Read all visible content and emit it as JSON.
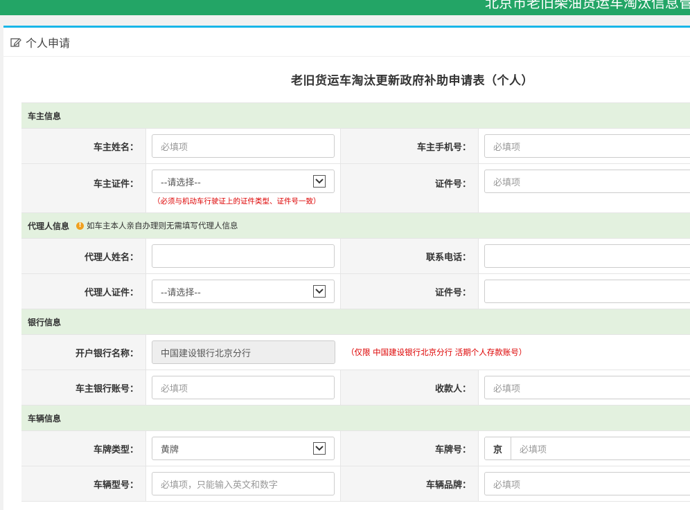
{
  "header": {
    "title": "北京市老旧柴油货运车淘汰信息管理"
  },
  "panel": {
    "title": "个人申请"
  },
  "form": {
    "title": "老旧货运车淘汰更新政府补助申请表（个人）",
    "owner_section": "车主信息",
    "owner_name_label": "车主姓名：",
    "owner_name_placeholder": "必填项",
    "owner_phone_label": "车主手机号：",
    "owner_phone_placeholder": "必填项",
    "owner_id_type_label": "车主证件：",
    "owner_id_type_value": "--请选择--",
    "owner_id_hint": "（必须与机动车行驶证上的证件类型、证件号一致）",
    "owner_id_no_label": "证件号：",
    "owner_id_no_placeholder": "必填项",
    "agent_section": "代理人信息",
    "agent_note": "如车主本人亲自办理则无需填写代理人信息",
    "agent_name_label": "代理人姓名：",
    "agent_phone_label": "联系电话：",
    "agent_id_type_label": "代理人证件：",
    "agent_id_type_value": "--请选择--",
    "agent_id_no_label": "证件号：",
    "bank_section": "银行信息",
    "bank_name_label": "开户银行名称：",
    "bank_name_value": "中国建设银行北京分行",
    "bank_hint": "（仅限 中国建设银行北京分行 活期个人存款账号）",
    "bank_account_label": "车主银行账号：",
    "bank_account_placeholder": "必填项",
    "payee_label": "收款人：",
    "payee_placeholder": "必填项",
    "vehicle_section": "车辆信息",
    "plate_type_label": "车牌类型：",
    "plate_type_value": "黄牌",
    "plate_no_label": "车牌号：",
    "plate_prefix": "京",
    "plate_no_placeholder": "必填项",
    "model_label": "车辆型号：",
    "model_placeholder": "必填项，只能输入英文和数字",
    "brand_label": "车辆品牌：",
    "brand_placeholder": "必填项"
  },
  "colors": {
    "topbar": "#23a566",
    "panel_accent": "#18b6e8",
    "section_bg": "#e3f1df",
    "hint": "#dd0000"
  }
}
